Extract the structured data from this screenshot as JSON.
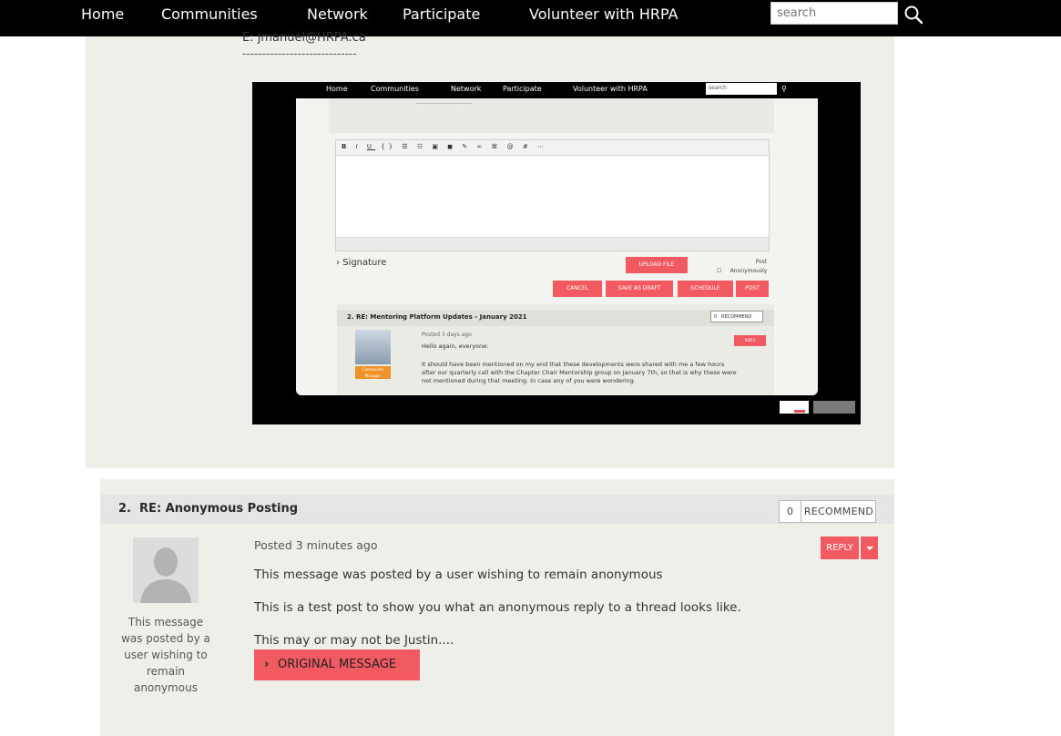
{
  "nav": {
    "items": [
      "Home",
      "Communities",
      "Network",
      "Participate",
      "Volunteer with HRPA"
    ],
    "search_placeholder": "search"
  },
  "previous_post": {
    "email": "E: jmanuel@HRPA.ca",
    "divider": "-----------------------------"
  },
  "embedded_screenshot": {
    "nav": [
      "Home",
      "Communities",
      "Network",
      "Participate",
      "Volunteer with HRPA"
    ],
    "search": "search",
    "signature": "Signature",
    "buttons": {
      "upload": "UPLOAD FILE",
      "cancel": "CANCEL",
      "save_draft": "SAVE AS DRAFT",
      "schedule": "SCHEDULE",
      "post": "POST"
    },
    "post_anon": "Post Anonymously",
    "reply_title": "2. RE: Mentoring Platform Updates - January 2021",
    "rec_count": "0",
    "rec_label": "RECOMMEND",
    "posted": "Posted 3 days ago",
    "reply_label": "REPLY",
    "badge": "Community Manager",
    "greeting": "Hello again, everyone:",
    "body_lines": [
      "It should have been mentioned on my end that these developments were shared with me a few hours",
      "after our quarterly call with the Chapter Chair Mentorship group on January 7th, so that is why these were",
      "not mentioned during that meeting. In case any of you were wondering."
    ]
  },
  "reply": {
    "number": "2.",
    "title": "RE: Anonymous Posting",
    "recommend_count": "0",
    "recommend_label": "RECOMMEND",
    "avatar_caption": "This message was posted by a user wishing to remain anonymous",
    "posted": "Posted 3 minutes ago",
    "reply_button": "REPLY",
    "messages": [
      "This message was posted by a user wishing to remain anonymous",
      "This is a test post to show you what an anonymous reply to a thread looks like.",
      "This may or may not be Justin...."
    ],
    "original_message_button": "ORIGINAL MESSAGE"
  },
  "colors": {
    "accent": "#f05a60",
    "nav_bg": "#000000",
    "panel_bg": "#efefea"
  }
}
